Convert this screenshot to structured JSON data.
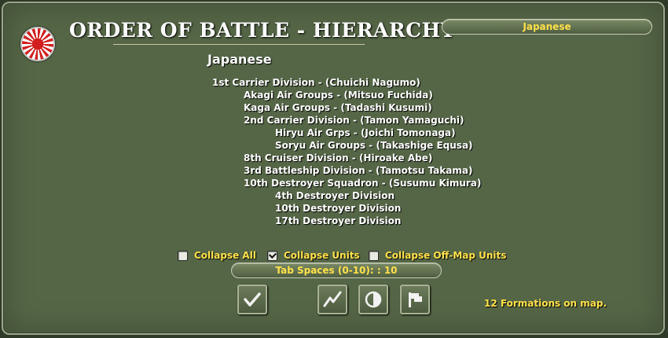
{
  "title": "ORDER OF BATTLE - HIERARCHY",
  "side_selector": {
    "value": "Japanese"
  },
  "nation_heading": "Japanese",
  "hierarchy": [
    {
      "text": "1st Carrier Division - (Chuichi Nagumo)",
      "level": 0
    },
    {
      "text": "Akagi Air Groups - (Mitsuo Fuchida)",
      "level": 1
    },
    {
      "text": "Kaga Air Groups - (Tadashi Kusumi)",
      "level": 1
    },
    {
      "text": "2nd Carrier Division - (Tamon Yamaguchi)",
      "level": 1
    },
    {
      "text": "Hiryu Air Grps - (Joichi Tomonaga)",
      "level": 2
    },
    {
      "text": "Soryu Air Groups - (Takashige Equsa)",
      "level": 2
    },
    {
      "text": "8th Cruiser Division - (Hiroake Abe)",
      "level": 1
    },
    {
      "text": "3rd Battleship Division - (Tamotsu Takama)",
      "level": 1
    },
    {
      "text": "10th Destroyer Squadron - (Susumu  Kimura)",
      "level": 1
    },
    {
      "text": "4th Destroyer Division",
      "level": 2
    },
    {
      "text": "10th Destroyer Division",
      "level": 2
    },
    {
      "text": "17th Destroyer Division",
      "level": 2
    }
  ],
  "options": {
    "collapse_all": {
      "label": "Collapse All",
      "checked": false
    },
    "collapse_units": {
      "label": "Collapse Units",
      "checked": true
    },
    "collapse_offmap": {
      "label": "Collapse Off-Map Units",
      "checked": false
    }
  },
  "tab_spaces": {
    "label": "Tab Spaces (0-10): : 10"
  },
  "buttons": {
    "ok": {
      "icon": "checkmark-icon"
    },
    "graph": {
      "icon": "zigzag-chart-icon"
    },
    "contrast": {
      "icon": "half-circle-icon"
    },
    "flag": {
      "icon": "flag-icon"
    }
  },
  "status": "12 Formations on map.",
  "colors": {
    "accent_text": "#ffe14a",
    "panel": "#556646",
    "text": "#ffffff"
  }
}
